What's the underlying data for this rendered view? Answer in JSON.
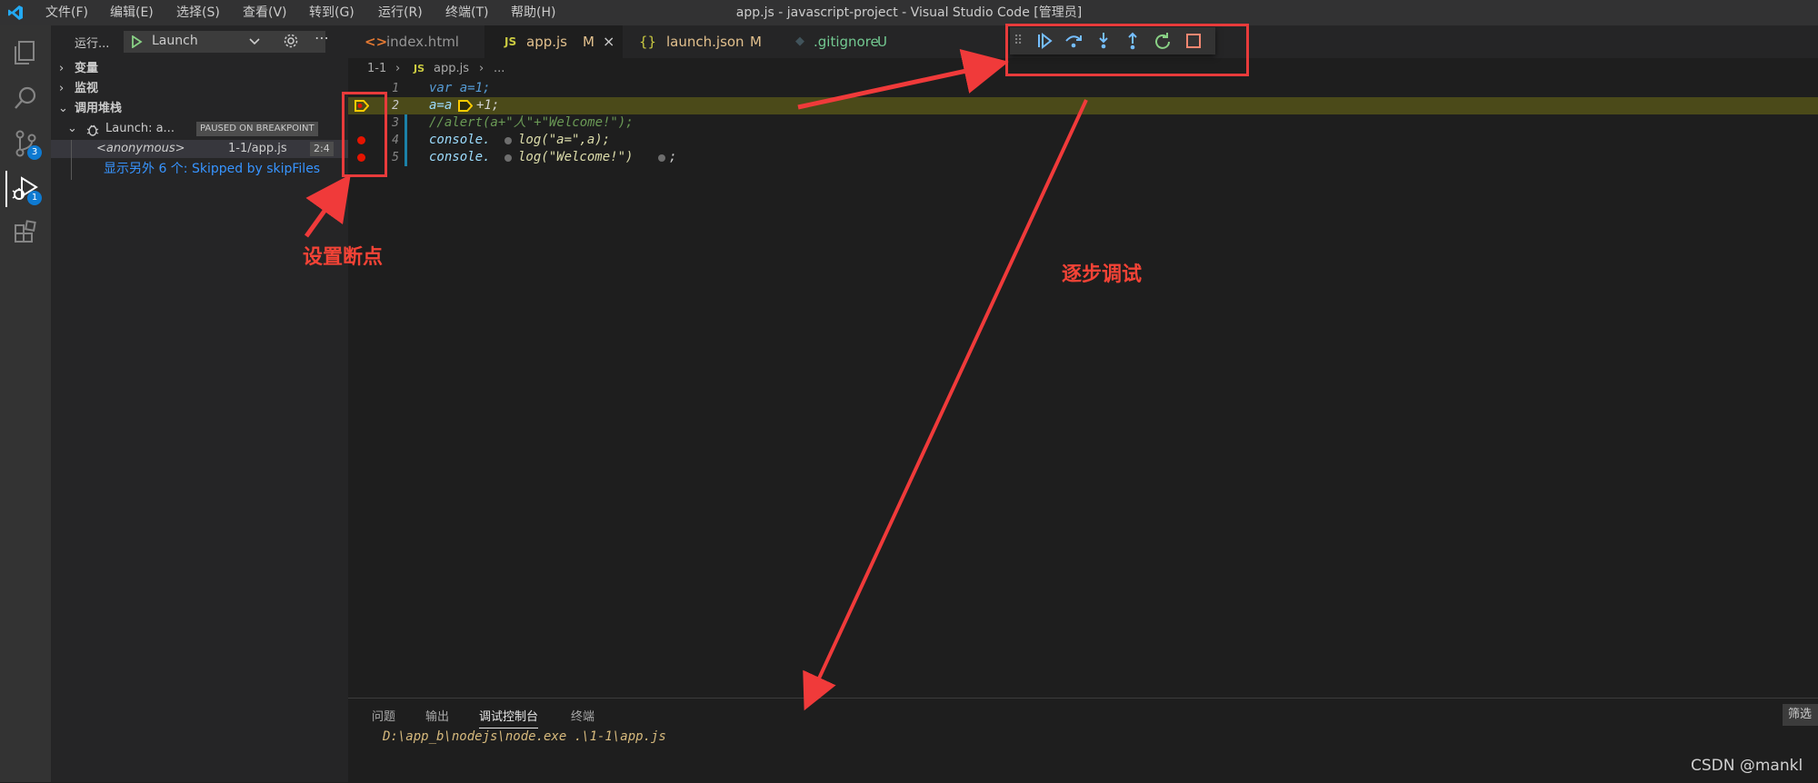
{
  "titlebar": {
    "menus": [
      "文件(F)",
      "编辑(E)",
      "选择(S)",
      "查看(V)",
      "转到(G)",
      "运行(R)",
      "终端(T)",
      "帮助(H)"
    ],
    "window_title": "app.js - javascript-project - Visual Studio Code [管理员]"
  },
  "activity_bar": {
    "items": [
      {
        "icon": "files-icon"
      },
      {
        "icon": "search-icon"
      },
      {
        "icon": "source-control-icon",
        "badge": "3"
      },
      {
        "icon": "run-debug-icon",
        "badge": "1"
      },
      {
        "icon": "extensions-icon"
      }
    ]
  },
  "sidebar": {
    "run_label": "运行...",
    "config_name": "Launch",
    "sections": {
      "variables": "变量",
      "watch": "监视",
      "call_stack": "调用堆栈"
    },
    "session": {
      "name": "Launch: a...",
      "status": "PAUSED ON BREAKPOINT"
    },
    "frame": {
      "name": "<anonymous>",
      "file": "1-1/app.js",
      "position": "2:4"
    },
    "skipped_text": "显示另外 6 个: Skipped by skipFiles"
  },
  "tabs": [
    {
      "label": "index.html",
      "icon": "html-icon",
      "status": "",
      "active": false
    },
    {
      "label": "app.js",
      "icon": "js-icon",
      "status": "M",
      "active": true
    },
    {
      "label": "launch.json",
      "icon": "json-icon",
      "status": "M",
      "active": false
    },
    {
      "label": ".gitignore",
      "icon": "git-icon",
      "status": "U",
      "active": false
    }
  ],
  "breadcrumbs": {
    "folder": "1-1",
    "file_icon": "JS",
    "file": "app.js",
    "more": "..."
  },
  "code": [
    {
      "num": "1",
      "text": "var a=1;"
    },
    {
      "num": "2",
      "text": "a=a",
      "rest": "+1;"
    },
    {
      "num": "3",
      "text": "//alert(a+\"人\"+\"Welcome!\");"
    },
    {
      "num": "4",
      "text": "console.",
      "rest": "log(\"a=\",a);"
    },
    {
      "num": "5",
      "text": "console.",
      "rest": "log(\"Welcome!\")",
      "tail": ";"
    }
  ],
  "debug_toolbar": {
    "buttons": [
      "drag-handle-icon",
      "continue-icon",
      "step-over-icon",
      "step-into-icon",
      "step-out-icon",
      "restart-icon",
      "stop-icon"
    ]
  },
  "annotations": {
    "breakpoint_label": "设置断点",
    "step_label": "逐步调试"
  },
  "panel": {
    "tabs": [
      "问题",
      "输出",
      "调试控制台",
      "终端"
    ],
    "active_tab": "调试控制台",
    "filter_label": "筛选",
    "output_line": "D:\\app_b\\nodejs\\node.exe .\\1-1\\app.js"
  },
  "watermark": "CSDN @mankl",
  "colors": {
    "accent": "#0e7ad1",
    "annotation_red": "#f44336",
    "highlight_line": "#4b4a19",
    "breakpoint": "#e51400",
    "keyword": "#569cd6",
    "comment": "#6a9955",
    "output_text": "#d7ba7d"
  }
}
